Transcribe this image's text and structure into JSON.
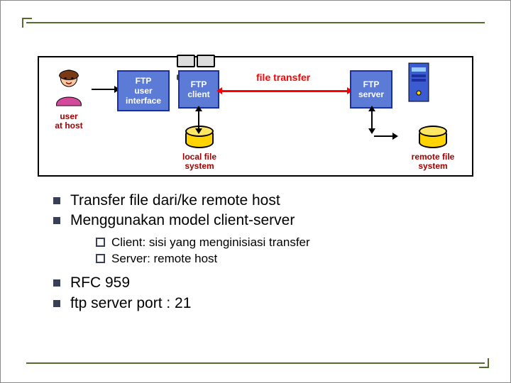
{
  "diagram": {
    "user_label": "user\nat host",
    "ftp_ui_label": "FTP\nuser\ninterface",
    "ftp_client_label": "FTP\nclient",
    "ftp_server_label": "FTP\nserver",
    "local_fs_label": "local file\nsystem",
    "remote_fs_label": "remote file\nsystem",
    "file_transfer_label": "file transfer"
  },
  "bullets": {
    "main": [
      "Transfer file dari/ke remote host",
      "Menggunakan model client-server",
      "RFC 959",
      "ftp server port : 21"
    ],
    "sub": [
      "Client: sisi yang menginisiasi transfer",
      "Server: remote host"
    ]
  }
}
